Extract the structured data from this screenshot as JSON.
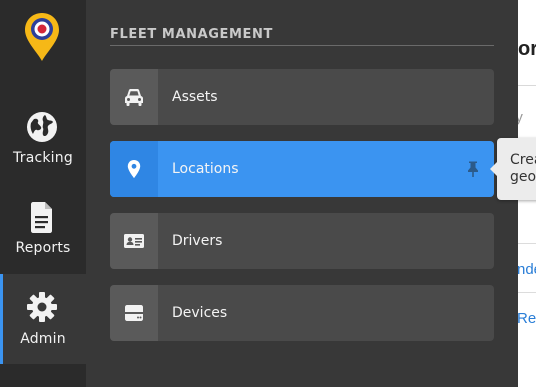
{
  "nav": {
    "items": [
      {
        "label": "Tracking",
        "icon": "globe-icon",
        "active": false
      },
      {
        "label": "Reports",
        "icon": "document-icon",
        "active": false
      },
      {
        "label": "Admin",
        "icon": "gear-icon",
        "active": true
      }
    ]
  },
  "panel": {
    "section_title": "FLEET MANAGEMENT",
    "items": [
      {
        "label": "Assets",
        "icon": "car-icon",
        "selected": false
      },
      {
        "label": "Locations",
        "icon": "location-pin-icon",
        "selected": true,
        "pinned_icon": "pin-icon"
      },
      {
        "label": "Drivers",
        "icon": "id-card-icon",
        "selected": false
      },
      {
        "label": "Devices",
        "icon": "storage-device-icon",
        "selected": false
      }
    ]
  },
  "tooltip": {
    "line1": "Crea",
    "line2": "geof"
  },
  "background": {
    "title_fragment": "or",
    "search_fragment": "by",
    "link1_fragment": "nde",
    "link2_fragment": "Ren"
  },
  "colors": {
    "rail_bg": "#2b2b2b",
    "panel_bg": "#383838",
    "item_bg": "#4a4a4a",
    "accent": "#3b94f1",
    "logo_yellow": "#f6b817",
    "logo_blue": "#2d3f9a",
    "logo_red": "#d3263a"
  }
}
